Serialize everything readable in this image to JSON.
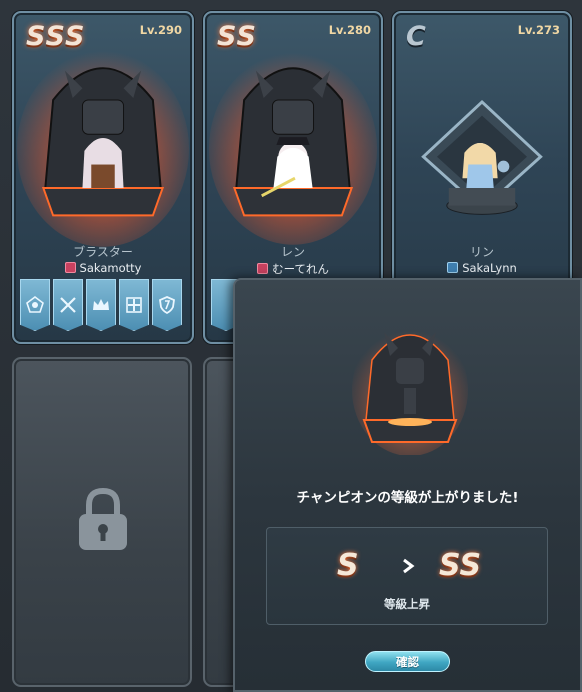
{
  "champions": [
    {
      "rank": "SSS",
      "level": "Lv.290",
      "name": "ブラスター",
      "owner": "Sakamotty",
      "badge": "red"
    },
    {
      "rank": "SS",
      "level": "Lv.280",
      "name": "レン",
      "owner": "むーてれん",
      "badge": "red"
    },
    {
      "rank": "C",
      "level": "Lv.273",
      "name": "リン",
      "owner": "SakaLynn",
      "badge": "blue"
    }
  ],
  "slot_icons": [
    "pentagon-emblem-icon",
    "crossed-swords-icon",
    "crown-icon",
    "cross-emblem-icon",
    "shield-icon"
  ],
  "locked_slots": 2,
  "dialog": {
    "message": "チャンピオンの等級が上がりました!",
    "from_rank": "S",
    "to_rank": "SS",
    "change_label": "等級上昇",
    "confirm_label": "確認"
  },
  "colors": {
    "card_border": "#6f8fa3",
    "slot_fill": "#4d8fb3",
    "confirm_button": "#3fa6c2",
    "rank_glow": "#ff7a3d"
  }
}
